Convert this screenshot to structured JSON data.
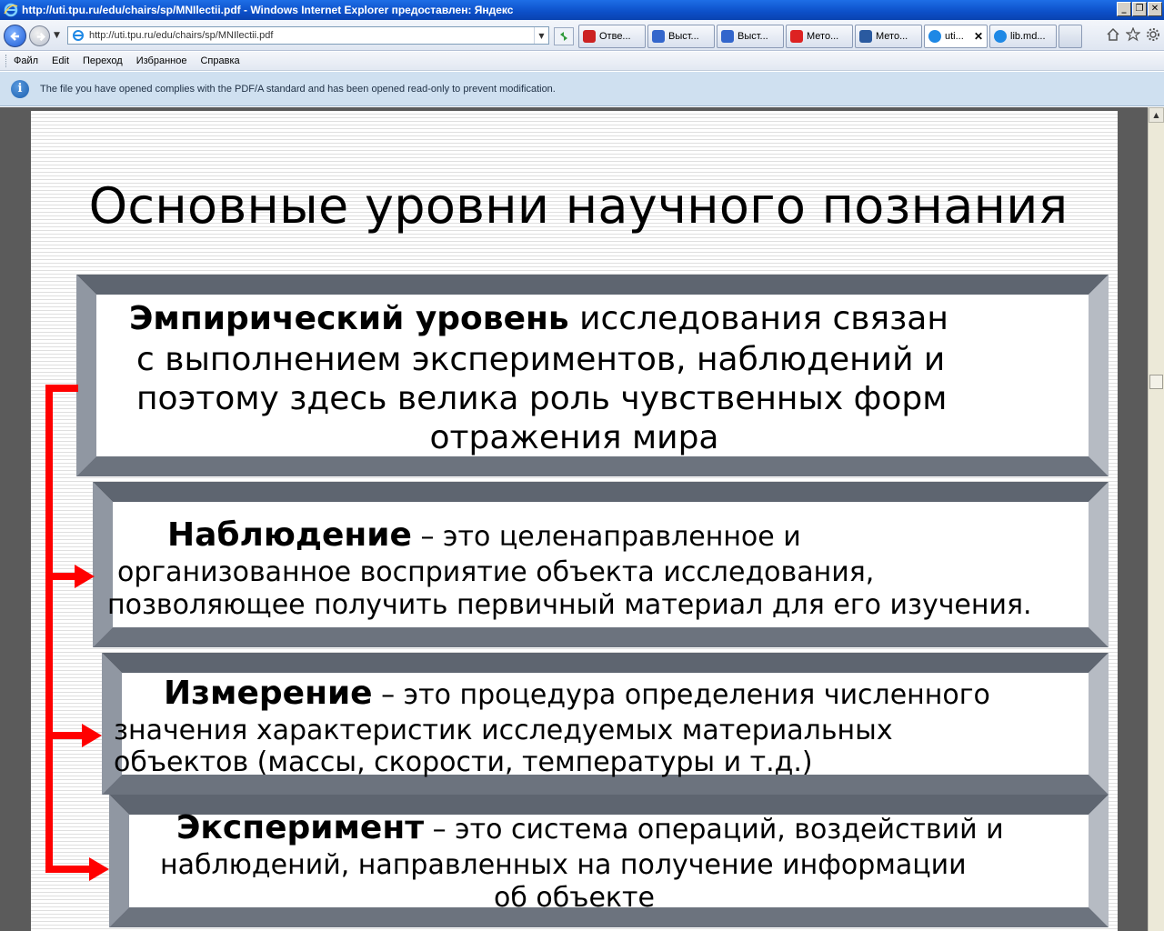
{
  "window": {
    "title": "http://uti.tpu.ru/edu/chairs/sp/MNIlectii.pdf - Windows Internet Explorer предоставлен: Яндекс",
    "buttons": [
      "_",
      "❐",
      "✕"
    ]
  },
  "navbar": {
    "address": "http://uti.tpu.ru/edu/chairs/sp/MNIlectii.pdf",
    "tabs": [
      {
        "label": "Отве...",
        "icon": "answers-icon",
        "color": "#cc2222"
      },
      {
        "label": "Выст...",
        "icon": "mail-icon",
        "color": "#3366cc"
      },
      {
        "label": "Выст...",
        "icon": "mail-icon",
        "color": "#3366cc"
      },
      {
        "label": "Мето...",
        "icon": "yandex-icon",
        "color": "#dd2222"
      },
      {
        "label": "Мето...",
        "icon": "site-icon",
        "color": "#2a5aa0"
      },
      {
        "label": "uti...",
        "icon": "ie-icon",
        "color": "#1e88e5",
        "active": true
      },
      {
        "label": "lib.md...",
        "icon": "ie-icon",
        "color": "#1e88e5"
      }
    ]
  },
  "menu": {
    "items": [
      "Файл",
      "Edit",
      "Переход",
      "Избранное",
      "Справка"
    ]
  },
  "infobar": {
    "text": "The file you have opened complies with the PDF/A standard and has been opened read-only to prevent modification."
  },
  "slide": {
    "title": "Основные уровни научного познания",
    "empirical": {
      "bold": "Эмпирический уровень",
      "line1": " исследования связан",
      "line2": "с выполнением экспериментов, наблюдений и",
      "line3": "поэтому здесь велика роль чувственных форм",
      "line4": "отражения мира"
    },
    "observation": {
      "bold": "Наблюдение",
      "line1": " – это целенаправленное и",
      "line2": "организованное восприятие объекта исследования,",
      "line3": "позволяющее получить первичный материал для его изучения."
    },
    "measurement": {
      "bold": "Измерение",
      "line1": " – это процедура определения численного",
      "line2": "значения характеристик исследуемых материальных",
      "line3": "объектов (массы, скорости, температуры и т.д.)"
    },
    "experiment": {
      "bold": "Эксперимент",
      "line1": " – это система операций, воздействий и",
      "line2": "наблюдений, направленных на получение информации",
      "line3": "об объекте"
    }
  },
  "colors": {
    "connector": "#ff0000",
    "titlebar": "#0c4fc8",
    "infobar": "#cfe0f0"
  }
}
